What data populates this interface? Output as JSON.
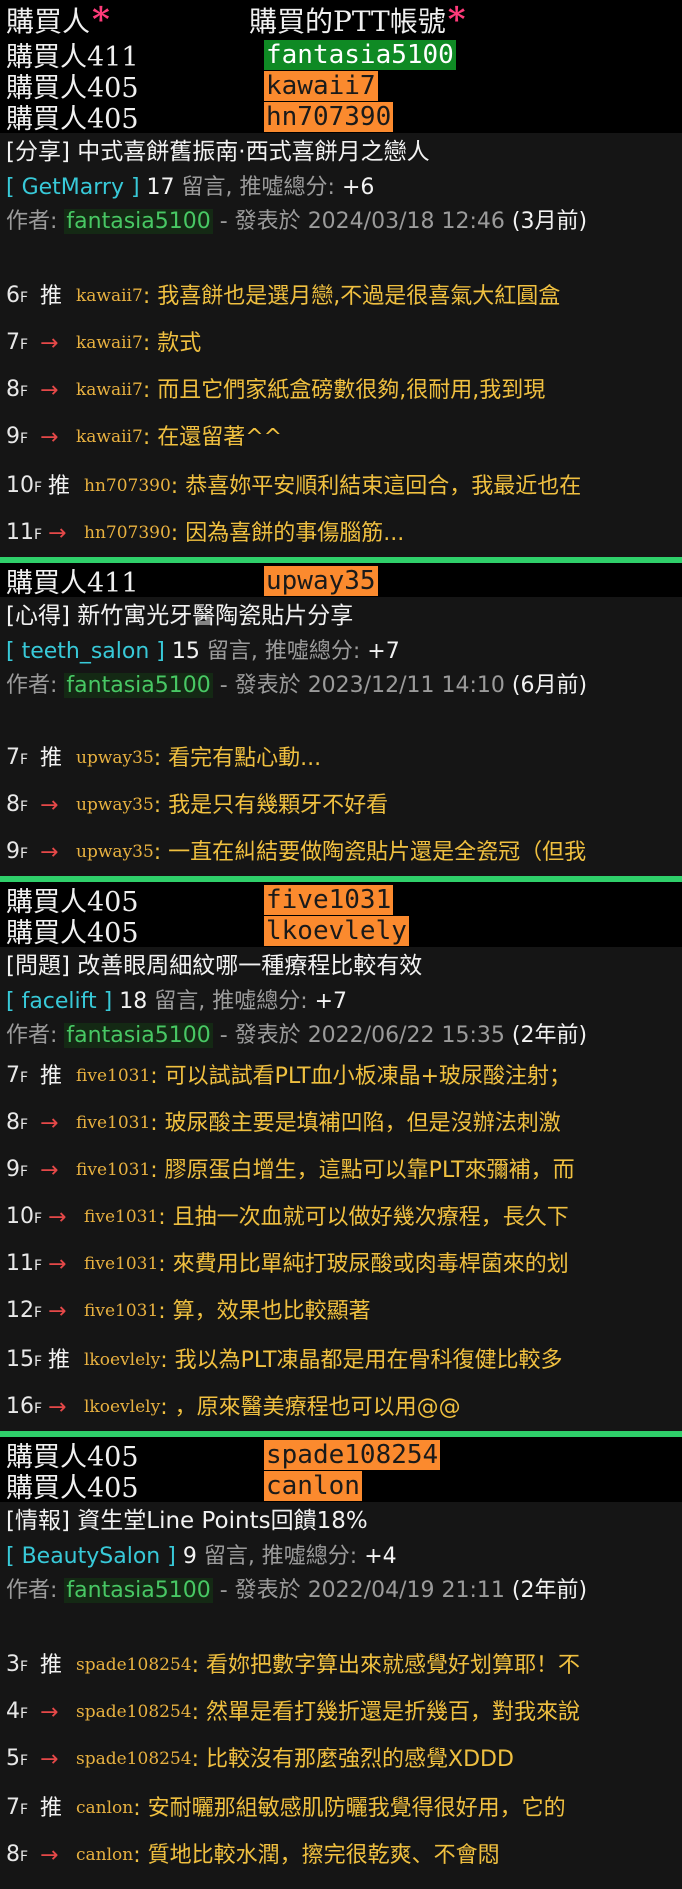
{
  "header": {
    "buyer_label": "購買人",
    "account_label": "購買的PTT帳號",
    "star": "*"
  },
  "groups": [
    {
      "buyers": [
        {
          "label": "購買人411",
          "account": "fantasia5100",
          "color": "green"
        },
        {
          "label": "購買人405",
          "account": "kawaii7",
          "color": "orange"
        },
        {
          "label": "購買人405",
          "account": "hn707390",
          "color": "orange"
        }
      ],
      "post": {
        "title": "[分享] 中式喜餅舊振南·西式喜餅月之戀人",
        "board": "[ GetMarry ]",
        "comment_count": "17",
        "comment_word": "留言, 推噓總分:",
        "score": "+6",
        "author_prefix": "作者:",
        "author": "fantasia5100",
        "posted_prefix": "- 發表於",
        "date": "2024/03/18 12:46",
        "ago": "(3月前)",
        "comments": [
          {
            "floor": "6",
            "tag": "推",
            "user": "kawaii7",
            "text": ": 我喜餅也是選月戀,不過是很喜氣大紅圓盒"
          },
          {
            "floor": "7",
            "tag": "→",
            "user": "kawaii7",
            "text": ": 款式"
          },
          {
            "floor": "8",
            "tag": "→",
            "user": "kawaii7",
            "text": ": 而且它們家紙盒磅數很夠,很耐用,我到現"
          },
          {
            "floor": "9",
            "tag": "→",
            "user": "kawaii7",
            "text": ": 在還留著^^"
          },
          {
            "floor": "10",
            "tag": "推",
            "user": "hn707390",
            "text": ": 恭喜妳平安順利結束這回合，我最近也在"
          },
          {
            "floor": "11",
            "tag": "→",
            "user": "hn707390",
            "text": ": 因為喜餅的事傷腦筋..."
          }
        ]
      }
    },
    {
      "buyers": [
        {
          "label": "購買人411",
          "account": "upway35",
          "color": "orange"
        }
      ],
      "post": {
        "title": "[心得] 新竹寓光牙醫陶瓷貼片分享",
        "board": "[ teeth_salon ]",
        "comment_count": "15",
        "comment_word": "留言, 推噓總分:",
        "score": "+7",
        "author_prefix": "作者:",
        "author": "fantasia5100",
        "posted_prefix": "- 發表於",
        "date": "2023/12/11 14:10",
        "ago": "(6月前)",
        "comments": [
          {
            "floor": "7",
            "tag": "推",
            "user": "upway35",
            "text": ": 看完有點心動..."
          },
          {
            "floor": "8",
            "tag": "→",
            "user": "upway35",
            "text": ": 我是只有幾顆牙不好看"
          },
          {
            "floor": "9",
            "tag": "→",
            "user": "upway35",
            "text": ": 一直在糾結要做陶瓷貼片還是全瓷冠（但我"
          }
        ]
      }
    },
    {
      "buyers": [
        {
          "label": "購買人405",
          "account": "five1031",
          "color": "orange"
        },
        {
          "label": "購買人405",
          "account": "lkoevlely",
          "color": "orange"
        }
      ],
      "post": {
        "title": "[問題] 改善眼周細紋哪一種療程比較有效",
        "board": "[ facelift ]",
        "comment_count": "18",
        "comment_word": "留言, 推噓總分:",
        "score": "+7",
        "author_prefix": "作者:",
        "author": "fantasia5100",
        "posted_prefix": "- 發表於",
        "date": "2022/06/22 15:35",
        "ago": "(2年前)",
        "comments": [
          {
            "floor": "7",
            "tag": "推",
            "user": "five1031",
            "text": ": 可以試試看PLT血小板凍晶+玻尿酸注射；"
          },
          {
            "floor": "8",
            "tag": "→",
            "user": "five1031",
            "text": ": 玻尿酸主要是填補凹陷，但是沒辦法刺激"
          },
          {
            "floor": "9",
            "tag": "→",
            "user": "five1031",
            "text": ": 膠原蛋白增生，這點可以靠PLT來彌補，而"
          },
          {
            "floor": "10",
            "tag": "→",
            "user": "five1031",
            "text": ": 且抽一次血就可以做好幾次療程，長久下"
          },
          {
            "floor": "11",
            "tag": "→",
            "user": "five1031",
            "text": ": 來費用比單純打玻尿酸或肉毒桿菌來的划"
          },
          {
            "floor": "12",
            "tag": "→",
            "user": "five1031",
            "text": ": 算，效果也比較顯著"
          },
          {
            "floor": "15",
            "tag": "推",
            "user": "lkoevlely",
            "text": ": 我以為PLT凍晶都是用在骨科復健比較多"
          },
          {
            "floor": "16",
            "tag": "→",
            "user": "lkoevlely",
            "text": ": ，原來醫美療程也可以用@@"
          }
        ]
      }
    },
    {
      "buyers": [
        {
          "label": "購買人405",
          "account": "spade108254",
          "color": "orange"
        },
        {
          "label": "購買人405",
          "account": "canlon",
          "color": "orange"
        }
      ],
      "post": {
        "title": "[情報] 資生堂Line Points回饋18%",
        "board": "[ BeautySalon ]",
        "comment_count": "9",
        "comment_word": "留言, 推噓總分:",
        "score": "+4",
        "author_prefix": "作者:",
        "author": "fantasia5100",
        "posted_prefix": "- 發表於",
        "date": "2022/04/19 21:11",
        "ago": "(2年前)",
        "comments": [
          {
            "floor": "3",
            "tag": "推",
            "user": "spade108254",
            "text": ": 看妳把數字算出來就感覺好划算耶！不"
          },
          {
            "floor": "4",
            "tag": "→",
            "user": "spade108254",
            "text": ": 然單是看打幾折還是折幾百，對我來說"
          },
          {
            "floor": "5",
            "tag": "→",
            "user": "spade108254",
            "text": ": 比較沒有那麼強烈的感覺XDDD"
          },
          {
            "floor": "7",
            "tag": "推",
            "user": "canlon",
            "text": ": 安耐曬那組敏感肌防曬我覺得很好用，它的"
          },
          {
            "floor": "8",
            "tag": "→",
            "user": "canlon",
            "text": ": 質地比較水潤，擦完很乾爽、不會悶"
          }
        ]
      }
    }
  ],
  "floor_suffix": "F",
  "colors": {
    "accent_green": "#2fcf6a",
    "account_orange": "#fb8a2e",
    "account_green": "#0f8a24",
    "board_cyan": "#38c9d8",
    "comment_yellow": "#f0c040",
    "arrow_red": "#e54848"
  }
}
